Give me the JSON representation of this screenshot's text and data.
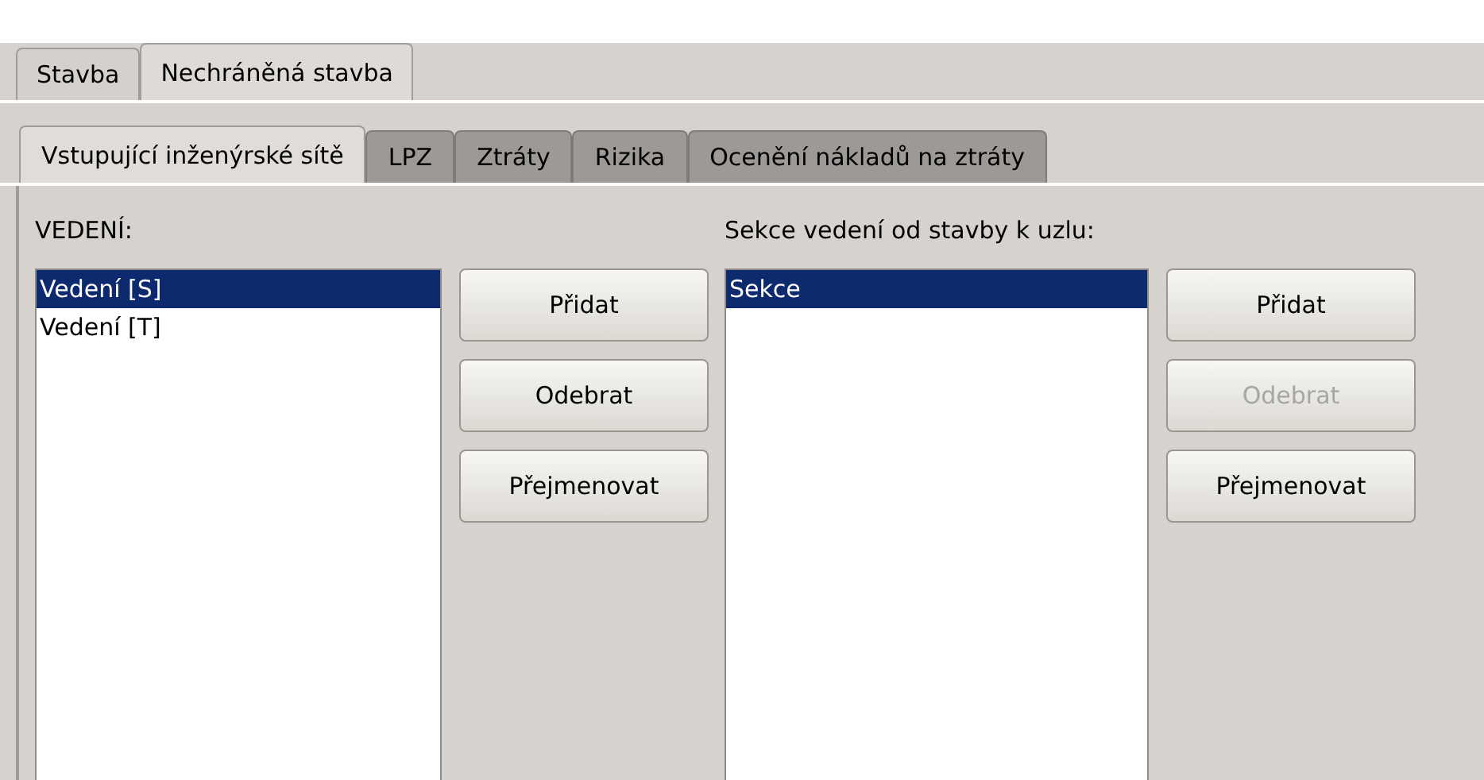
{
  "outer_tabs": [
    {
      "label": "Stavba",
      "selected": false
    },
    {
      "label": "Nechráněná stavba",
      "selected": true
    }
  ],
  "inner_tabs": [
    {
      "label": "Vstupující inženýrské sítě",
      "selected": true
    },
    {
      "label": "LPZ",
      "selected": false
    },
    {
      "label": "Ztráty",
      "selected": false
    },
    {
      "label": "Rizika",
      "selected": false
    },
    {
      "label": "Ocenění nákladů na ztráty",
      "selected": false
    }
  ],
  "groups": [
    {
      "label": "VEDENÍ:",
      "items": [
        {
          "label": "Vedení [S]",
          "selected": true
        },
        {
          "label": "Vedení [T]",
          "selected": false
        }
      ],
      "buttons": [
        {
          "label": "Přidat",
          "disabled": false
        },
        {
          "label": "Odebrat",
          "disabled": false
        },
        {
          "label": "Přejmenovat",
          "disabled": false
        }
      ]
    },
    {
      "label": "Sekce vedení od stavby k uzlu:",
      "items": [
        {
          "label": "Sekce",
          "selected": true
        }
      ],
      "buttons": [
        {
          "label": "Přidat",
          "disabled": false
        },
        {
          "label": "Odebrat",
          "disabled": true
        },
        {
          "label": "Přejmenovat",
          "disabled": false
        }
      ]
    }
  ]
}
